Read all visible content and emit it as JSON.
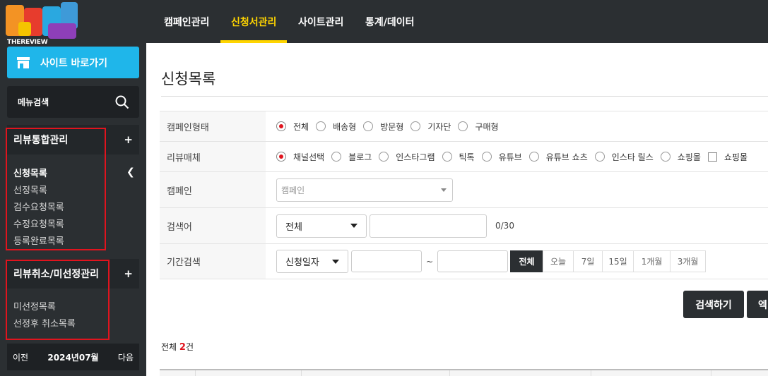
{
  "brand": {
    "logo_text": "THEREVIEW"
  },
  "sidebar": {
    "site_button": "사이트 바로가기",
    "menu_search": "메뉴검색",
    "sections": [
      {
        "title": "리뷰통합관리",
        "toggle": "+",
        "items": [
          "신청목록",
          "선정목록",
          "검수요청목록",
          "수정요청목록",
          "등록완료목록"
        ],
        "active_index": 0
      },
      {
        "title": "리뷰취소/미선정관리",
        "toggle": "+",
        "items": [
          "미선정목록",
          "선정후 취소목록"
        ]
      }
    ],
    "month_nav": {
      "prev": "이전",
      "current": "2024년07월",
      "next": "다음"
    }
  },
  "topnav": {
    "tabs": [
      "캠페인관리",
      "신청서관리",
      "사이트관리",
      "통계/데이터"
    ],
    "active_index": 1
  },
  "main": {
    "title": "신청목록",
    "form": {
      "campaign_type": {
        "label": "캠페인형태",
        "options": [
          "전체",
          "배송형",
          "방문형",
          "기자단",
          "구매형"
        ],
        "selected": 0
      },
      "review_media": {
        "label": "리뷰매체",
        "options": [
          "채널선택",
          "블로그",
          "인스타그램",
          "틱톡",
          "유튜브",
          "유튜브 쇼츠",
          "인스타 릴스",
          "쇼핑몰"
        ],
        "checkbox_option": "쇼핑몰",
        "selected": 0
      },
      "campaign": {
        "label": "캠페인",
        "placeholder": "캠페인"
      },
      "keyword": {
        "label": "검색어",
        "select_value": "전체",
        "input_value": "",
        "counter": "0/30"
      },
      "period": {
        "label": "기간검색",
        "select_value": "신청일자",
        "from": "",
        "separator": "~",
        "to": "",
        "buttons": [
          "전체",
          "오늘",
          "7일",
          "15일",
          "1개월",
          "3개월"
        ],
        "active_index": 0
      }
    },
    "actions": {
      "search": "검색하기",
      "excel": "엑"
    },
    "total": {
      "prefix": "전체 ",
      "count": "2",
      "suffix": "건"
    }
  },
  "colors": {
    "sidebar_bg": "#2b2f32",
    "accent_blue": "#1fb6ea",
    "active_tab": "#ffd500",
    "highlight_red": "#e0141e"
  }
}
